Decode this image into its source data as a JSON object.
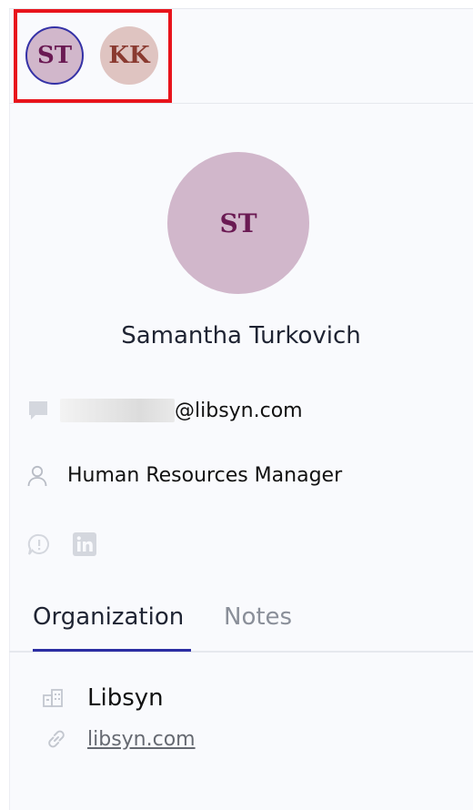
{
  "avatars": [
    {
      "initials": "ST",
      "color_bg": "#d1b7cb",
      "color_text": "#6a1a53",
      "selected": true
    },
    {
      "initials": "KK",
      "color_bg": "#dfc4c1",
      "color_text": "#8a3a30",
      "selected": false
    }
  ],
  "highlight_color": "#e8141c",
  "profile": {
    "initials": "ST",
    "name": "Samantha Turkovich",
    "email_domain": "@libsyn.com",
    "job_title": "Human Resources Manager"
  },
  "icons": {
    "email": "chat-bubble-icon",
    "job": "person-icon",
    "social_1": "speech-alert-icon",
    "social_2": "linkedin-icon",
    "org": "building-icon",
    "link": "link-icon"
  },
  "tabs": [
    {
      "label": "Organization",
      "active": true
    },
    {
      "label": "Notes",
      "active": false
    }
  ],
  "accent_color": "#2c2ea3",
  "organization": {
    "name": "Libsyn",
    "website": "libsyn.com"
  }
}
